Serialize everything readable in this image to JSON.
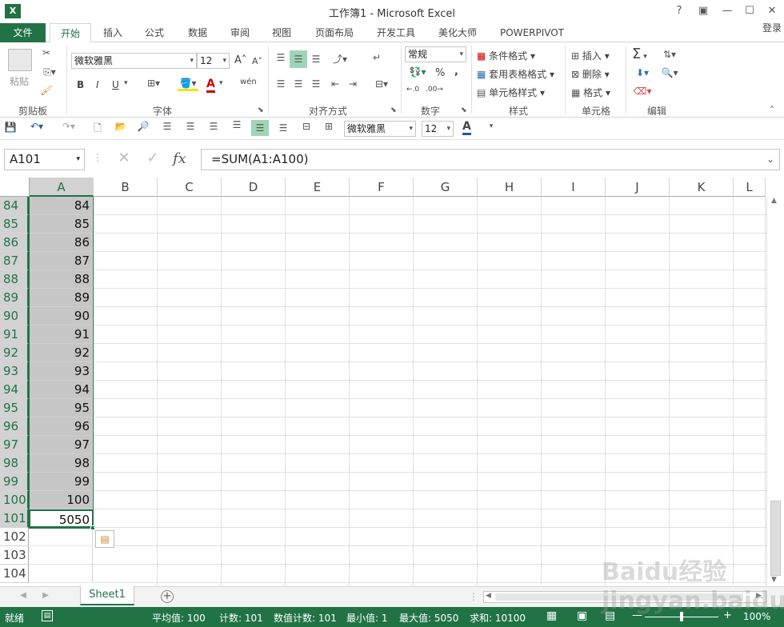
{
  "window": {
    "title": "工作簿1 - Microsoft Excel",
    "app_icon": "X",
    "help": "?",
    "login": "登录"
  },
  "tabs": [
    {
      "label": "文件"
    },
    {
      "label": "开始"
    },
    {
      "label": "插入"
    },
    {
      "label": "公式"
    },
    {
      "label": "数据"
    },
    {
      "label": "审阅"
    },
    {
      "label": "视图"
    },
    {
      "label": "页面布局"
    },
    {
      "label": "开发工具"
    },
    {
      "label": "美化大师"
    },
    {
      "label": "POWERPIVOT"
    }
  ],
  "ribbon": {
    "clipboard": {
      "paste": "粘贴",
      "label": "剪贴板"
    },
    "font": {
      "name": "微软雅黑",
      "size": "12",
      "label": "字体",
      "bold": "B",
      "italic": "I",
      "underline": "U",
      "grow": "A",
      "shrink": "A",
      "color": "A",
      "wen": "wén"
    },
    "align": {
      "label": "对齐方式"
    },
    "number": {
      "format": "常规",
      "label": "数字",
      "percent": "%",
      "comma": ","
    },
    "styles": {
      "cond": "条件格式",
      "table": "套用表格格式",
      "cell": "单元格样式",
      "label": "样式"
    },
    "cells": {
      "insert": "插入",
      "delete": "删除",
      "format": "格式",
      "label": "单元格"
    },
    "editing": {
      "label": "编辑",
      "sum": "Σ"
    }
  },
  "qat": {
    "font": "微软雅黑",
    "size": "12",
    "color_glyph": "A"
  },
  "formula_bar": {
    "name_box": "A101",
    "fx": "fx",
    "formula": "=SUM(A1:A100)"
  },
  "columns": [
    "A",
    "B",
    "C",
    "D",
    "E",
    "F",
    "G",
    "H",
    "I",
    "J",
    "K",
    "L"
  ],
  "rows": [
    {
      "num": "84",
      "a": "84"
    },
    {
      "num": "85",
      "a": "85"
    },
    {
      "num": "86",
      "a": "86"
    },
    {
      "num": "87",
      "a": "87"
    },
    {
      "num": "88",
      "a": "88"
    },
    {
      "num": "89",
      "a": "89"
    },
    {
      "num": "90",
      "a": "90"
    },
    {
      "num": "91",
      "a": "91"
    },
    {
      "num": "92",
      "a": "92"
    },
    {
      "num": "93",
      "a": "93"
    },
    {
      "num": "94",
      "a": "94"
    },
    {
      "num": "95",
      "a": "95"
    },
    {
      "num": "96",
      "a": "96"
    },
    {
      "num": "97",
      "a": "97"
    },
    {
      "num": "98",
      "a": "98"
    },
    {
      "num": "99",
      "a": "99"
    },
    {
      "num": "100",
      "a": "100"
    },
    {
      "num": "101",
      "a": "5050"
    },
    {
      "num": "102",
      "a": ""
    },
    {
      "num": "103",
      "a": ""
    },
    {
      "num": "104",
      "a": ""
    }
  ],
  "sheet": {
    "name": "Sheet1",
    "add": "+"
  },
  "status": {
    "ready": "就绪",
    "avg": "平均值: 100",
    "count": "计数: 101",
    "numcount": "数值计数: 101",
    "min": "最小值: 1",
    "max": "最大值: 5050",
    "sum": "求和: 10100",
    "zoom": "100%",
    "zoom_level": 1.0
  },
  "watermark": "Baidu经验 jingyan.baidu.com",
  "colors": {
    "accent": "#217346",
    "selection": "#c6c6c6"
  }
}
